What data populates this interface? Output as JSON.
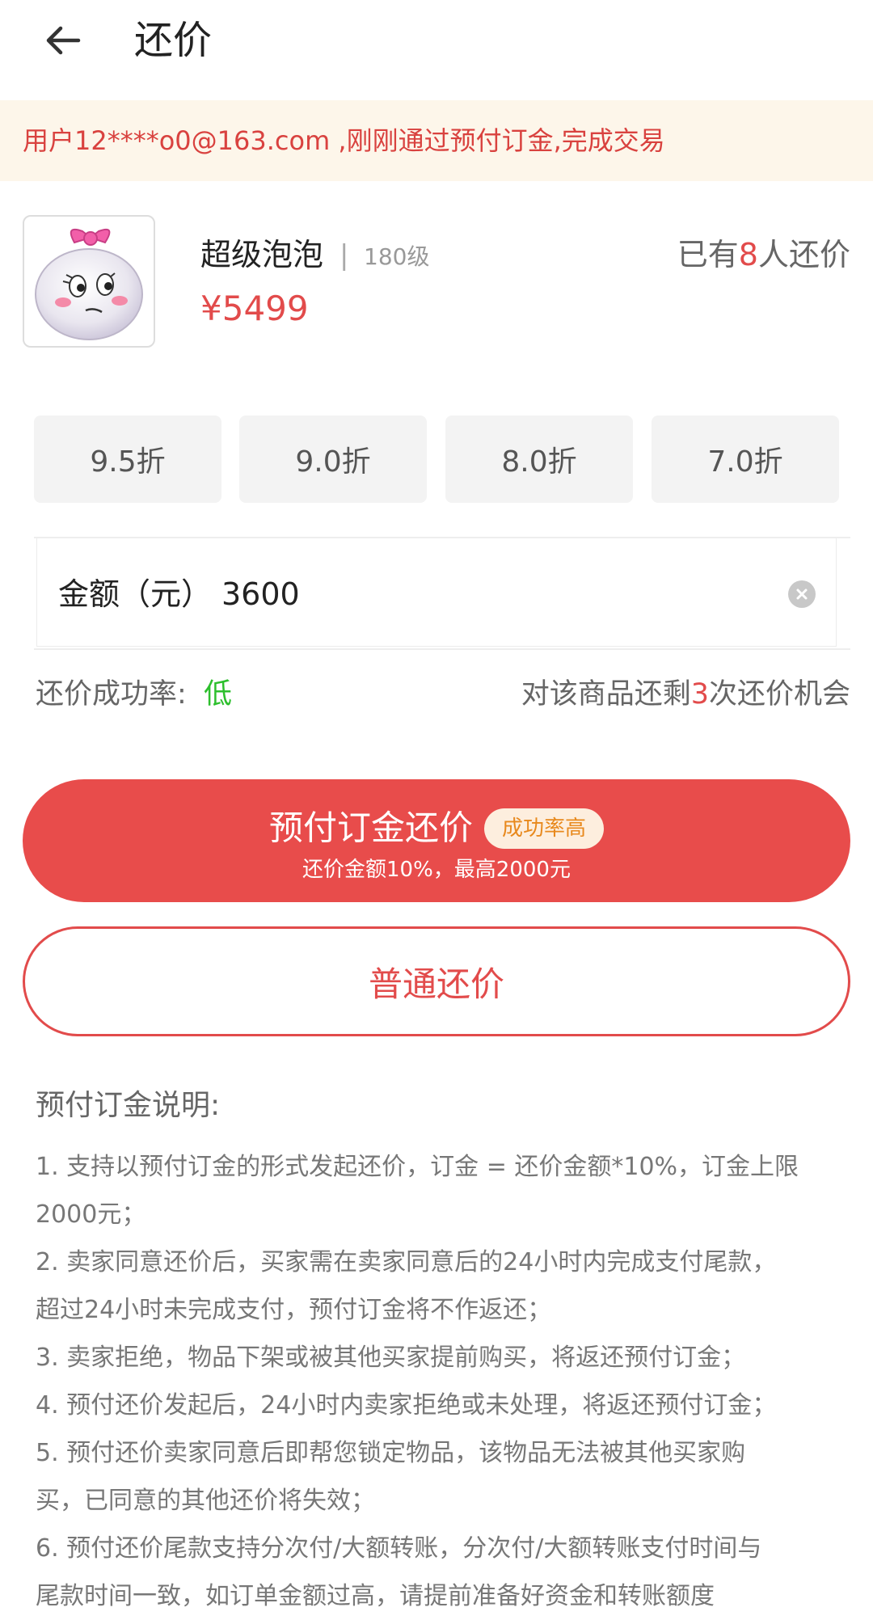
{
  "header": {
    "title": "还价"
  },
  "notice": {
    "text": "用户12****o0@163.com ,刚刚通过预付订金,完成交易"
  },
  "product": {
    "name": "超级泡泡",
    "separator": "|",
    "level": "180级",
    "price": "¥5499",
    "bids_prefix": "已有",
    "bids_count": "8",
    "bids_suffix": "人还价"
  },
  "discounts": [
    "9.5折",
    "9.0折",
    "8.0折",
    "7.0折"
  ],
  "amount": {
    "label": "金额（元）",
    "value": "3600"
  },
  "rate": {
    "label": "还价成功率:",
    "value": "低"
  },
  "chances": {
    "prefix": "对该商品还剩",
    "count": "3",
    "suffix": "次还价机会"
  },
  "prepay_button": {
    "label": "预付订金还价",
    "badge": "成功率高",
    "sub": "还价金额10%，最高2000元"
  },
  "normal_button": {
    "label": "普通还价"
  },
  "explanation": {
    "title": "预付订金说明:",
    "lines": [
      "1. 支持以预付订金的形式发起还价，订金 = 还价金额*10%，订金上限",
      "2000元；",
      "2. 卖家同意还价后，买家需在卖家同意后的24小时内完成支付尾款，",
      "超过24小时未完成支付，预付订金将不作返还；",
      "3. 卖家拒绝，物品下架或被其他买家提前购买，将返还预付订金；",
      "4. 预付还价发起后，24小时内卖家拒绝或未处理，将返还预付订金；",
      "5. 预付还价卖家同意后即帮您锁定物品，该物品无法被其他买家购",
      "买，已同意的其他还价将失效；",
      "6. 预付还价尾款支持分次付/大额转账，分次付/大额转账支付时间与",
      "尾款时间一致，如订单金额过高，请提前准备好资金和转账额度"
    ]
  },
  "colors": {
    "accent": "#e84c4b",
    "success": "#2dbf2d",
    "notice_bg": "#fdf6ea"
  },
  "icons": {
    "back": "arrow-left-icon",
    "clear": "clear-circle-icon",
    "avatar": "bubble-character-avatar"
  }
}
